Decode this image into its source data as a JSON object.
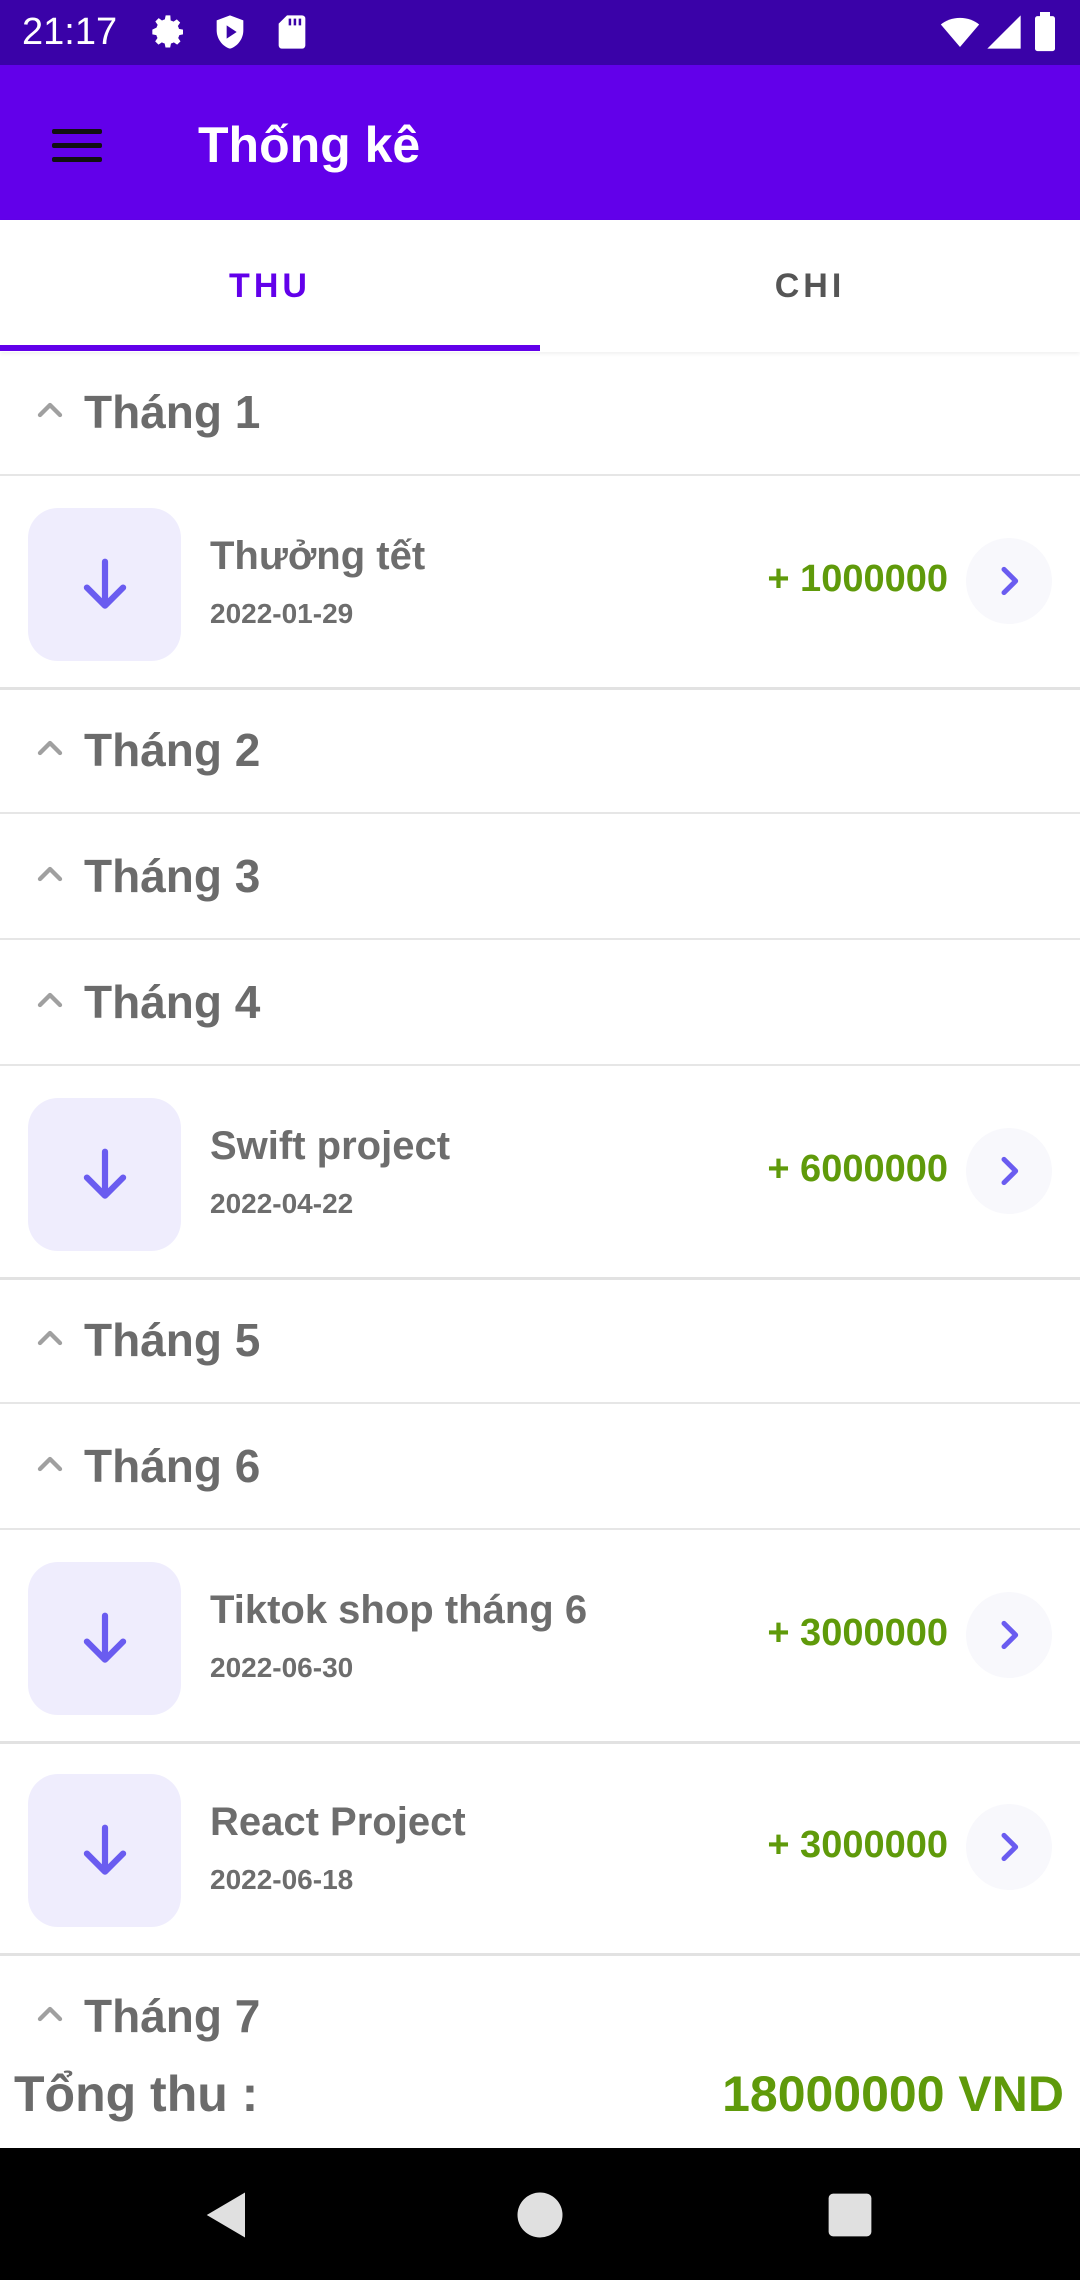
{
  "status_bar": {
    "time": "21:17",
    "left_icons": [
      "gear-icon",
      "shield-play-icon",
      "sd-card-icon"
    ],
    "right_icons": [
      "wifi-icon",
      "signal-icon",
      "battery-icon"
    ]
  },
  "app_bar": {
    "title": "Thống kê",
    "menu_icon": "hamburger-menu-icon",
    "color": "#6200ea"
  },
  "tabs": [
    {
      "label": "THU",
      "selected": true
    },
    {
      "label": "CHI",
      "selected": false
    }
  ],
  "months": [
    {
      "label": "Tháng 1",
      "items": [
        {
          "title": "Thưởng tết",
          "date": "2022-01-29",
          "amount": "+ 1000000"
        }
      ]
    },
    {
      "label": "Tháng 2",
      "items": []
    },
    {
      "label": "Tháng 3",
      "items": []
    },
    {
      "label": "Tháng 4",
      "items": [
        {
          "title": "Swift project",
          "date": "2022-04-22",
          "amount": "+ 6000000"
        }
      ]
    },
    {
      "label": "Tháng 5",
      "items": []
    },
    {
      "label": "Tháng 6",
      "items": [
        {
          "title": "Tiktok shop tháng 6",
          "date": "2022-06-30",
          "amount": "+ 3000000"
        },
        {
          "title": "React Project",
          "date": "2022-06-18",
          "amount": "+ 3000000"
        }
      ]
    },
    {
      "label": "Tháng 7",
      "items": []
    }
  ],
  "total": {
    "label": "Tổng thu :",
    "value": "18000000 VND"
  },
  "colors": {
    "accent": "#6200ea",
    "income": "#5f9a0a",
    "status_bar": "#3a02a8"
  },
  "nav_bar": {
    "icons": [
      "back-icon",
      "home-icon",
      "recents-icon"
    ]
  }
}
